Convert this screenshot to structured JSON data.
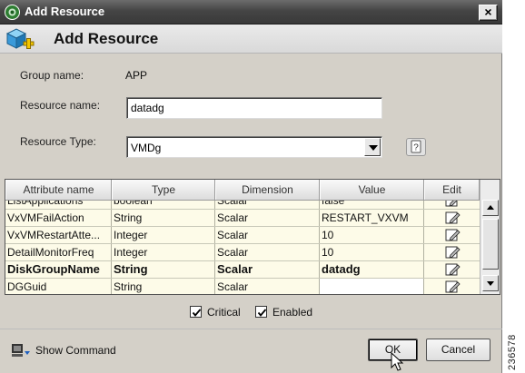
{
  "window": {
    "title": "Add Resource",
    "close_symbol": "×"
  },
  "header": {
    "title": "Add Resource"
  },
  "form": {
    "group_label": "Group name:",
    "group_value": "APP",
    "resource_name_label": "Resource name:",
    "resource_name_value": "datadg",
    "resource_type_label": "Resource Type:",
    "resource_type_value": "VMDg"
  },
  "table": {
    "columns": [
      "Attribute name",
      "Type",
      "Dimension",
      "Value",
      "Edit"
    ],
    "rows": [
      {
        "name": "ListApplications",
        "type": "boolean",
        "dimension": "Scalar",
        "value": "false",
        "bold": false
      },
      {
        "name": "VxVMFailAction",
        "type": "String",
        "dimension": "Scalar",
        "value": "RESTART_VXVM",
        "bold": false
      },
      {
        "name": "VxVMRestartAtte...",
        "type": "Integer",
        "dimension": "Scalar",
        "value": "10",
        "bold": false
      },
      {
        "name": "DetailMonitorFreq",
        "type": "Integer",
        "dimension": "Scalar",
        "value": "10",
        "bold": false
      },
      {
        "name": "DiskGroupName",
        "type": "String",
        "dimension": "Scalar",
        "value": "datadg",
        "bold": true
      },
      {
        "name": "DGGuid",
        "type": "String",
        "dimension": "Scalar",
        "value": "",
        "bold": false
      }
    ]
  },
  "options": {
    "critical_label": "Critical",
    "critical_checked": true,
    "enabled_label": "Enabled",
    "enabled_checked": true
  },
  "footer": {
    "show_command_label": "Show Command",
    "ok_label": "OK",
    "cancel_label": "Cancel"
  },
  "figure_id": "236578",
  "colors": {
    "title_bar": "#3c3c3c",
    "dialog_bg": "#d4d0c8",
    "table_bg": "#fdfbe8"
  }
}
